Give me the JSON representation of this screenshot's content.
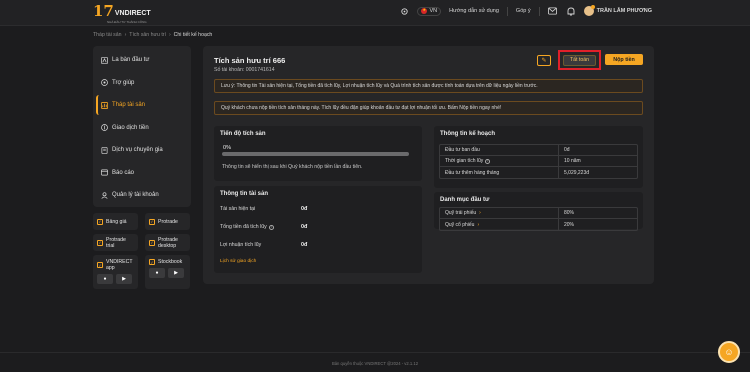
{
  "header": {
    "logo_mark": "17",
    "logo_brand": "VNDIRECT",
    "logo_sub": "NHÀ ĐẦU TƯ THÀNH CÔNG",
    "lang_code": "VN",
    "guide_label": "Hướng dẫn sử dụng",
    "feedback_label": "Góp ý",
    "user_name": "TRẦN LÂM PHƯƠNG"
  },
  "breadcrumb": [
    "Tháp tài sản",
    "Tích sản hưu trí",
    "Chi tiết kế hoạch"
  ],
  "sidebar": {
    "items": [
      {
        "label": "La bàn đầu tư",
        "icon": "compass-icon",
        "glyph": "◎"
      },
      {
        "label": "Trợ giúp",
        "icon": "help-icon",
        "glyph": "?"
      },
      {
        "label": "Tháp tài sản",
        "icon": "tower-icon",
        "glyph": "▣"
      },
      {
        "label": "Giao dịch tiền",
        "icon": "money-icon",
        "glyph": "◉"
      },
      {
        "label": "Dịch vụ chuyên gia",
        "icon": "book-icon",
        "glyph": "▤"
      },
      {
        "label": "Báo cáo",
        "icon": "report-icon",
        "glyph": "▭"
      },
      {
        "label": "Quản lý tài khoản",
        "icon": "user-icon",
        "glyph": "☺"
      }
    ],
    "tools": {
      "bang_gia": "Bảng giá",
      "protrade": "Protrade",
      "protrade_trial": "Protrade trial",
      "protrade_desktop": "Protrade desktop",
      "vndirect_app": "VNDIRECT app",
      "stockbook": "Stockbook"
    }
  },
  "plan": {
    "title": "Tích sản hưu trí 666",
    "account": "Số tài khoản: 0001741614",
    "settle_label": "Tất toán",
    "deposit_label": "Nộp tiền",
    "note1": "Lưu ý: Thông tin Tài sản hiện tại, Tổng tiền đã tích lũy, Lợi nhuận tích lũy và Quá trình tích sản được tính toán dựa trên dữ liệu ngày liền trước.",
    "note2": "Quý khách chưa nộp tiền tích sản tháng này. Tích lũy đều đặn giúp khoản đầu tư đạt lợi nhuận tối ưu. Bấm Nộp tiền ngay nhé!"
  },
  "progress": {
    "title": "Tiến độ tích sản",
    "percent_label": "0%",
    "percent_value": 0,
    "hint": "Thông tin sẽ hiển thị sau khi Quý khách nộp tiền lần đầu tiên."
  },
  "asset_info": {
    "title": "Thông tin tài sản",
    "rows": [
      {
        "label": "Tài sản hiện tại",
        "value": "0đ"
      },
      {
        "label": "Tổng tiền đã tích lũy",
        "value": "0đ"
      },
      {
        "label": "Lợi nhuận tích lũy",
        "value": "0đ"
      }
    ],
    "history_link": "Lịch sử giao dịch"
  },
  "plan_info": {
    "title": "Thông tin kế hoạch",
    "rows": [
      {
        "label": "Đầu tư ban đầu",
        "value": "0đ"
      },
      {
        "label": "Thời gian tích lũy",
        "value": "10 năm"
      },
      {
        "label": "Đầu tư thêm hàng tháng",
        "value": "5,029,223đ"
      }
    ]
  },
  "portfolio": {
    "title": "Danh mục đầu tư",
    "rows": [
      {
        "label": "Quỹ trái phiếu",
        "value": "80%"
      },
      {
        "label": "Quỹ cổ phiếu",
        "value": "20%"
      }
    ]
  },
  "footer": {
    "text": "Bản quyền thuộc VNDIRECT @2024 - v2.1.12"
  },
  "colors": {
    "accent": "#f5a623",
    "highlight": "#e0202a",
    "background": "#1c1c1e"
  }
}
